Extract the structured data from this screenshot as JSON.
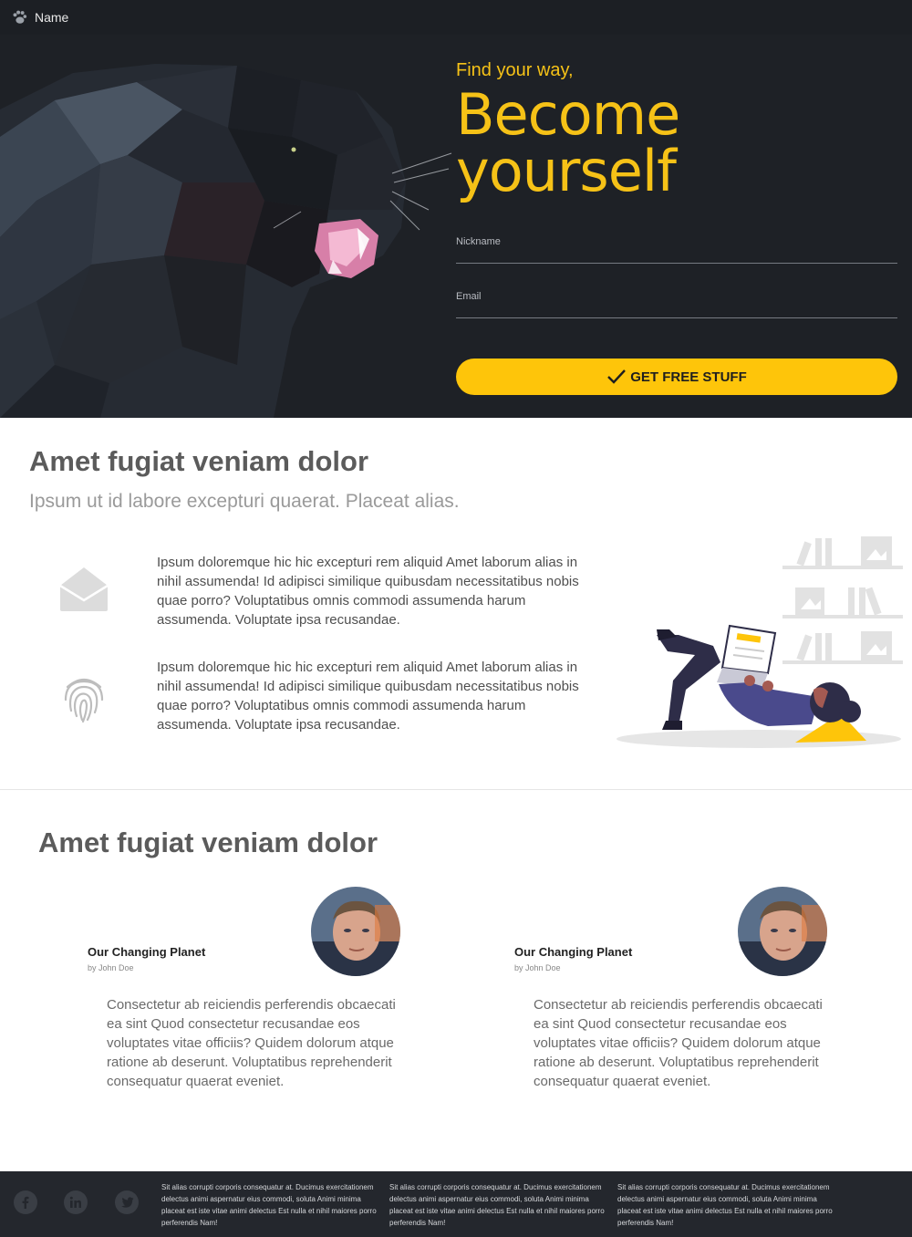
{
  "topbar": {
    "brand_name": "Name",
    "brand_icon": "paw-icon"
  },
  "hero": {
    "tagline": "Find your way,",
    "headline": "Become yourself",
    "nickname_label": "Nickname",
    "nickname_value": "",
    "email_label": "Email",
    "email_value": "",
    "cta_label": "GET FREE STUFF",
    "accent_color": "#fec50a",
    "background_color": "#1e2126"
  },
  "features": {
    "title": "Amet fugiat veniam dolor",
    "subtitle": "Ipsum ut id labore excepturi quaerat. Placeat alias.",
    "items": [
      {
        "icon": "envelope-icon",
        "text": "Ipsum doloremque hic hic excepturi rem aliquid Amet laborum alias in nihil assumenda! Id adipisci similique quibusdam necessitatibus nobis quae porro? Voluptatibus omnis commodi assumenda harum assumenda. Voluptate ipsa recusandae."
      },
      {
        "icon": "fingerprint-icon",
        "text": "Ipsum doloremque hic hic excepturi rem aliquid Amet laborum alias in nihil assumenda! Id adipisci similique quibusdam necessitatibus nobis quae porro? Voluptatibus omnis commodi assumenda harum assumenda. Voluptate ipsa recusandae."
      }
    ]
  },
  "articles": {
    "title": "Amet fugiat veniam dolor",
    "cards": [
      {
        "heading": "Our Changing Planet",
        "byline": "by John Doe",
        "body": "Consectetur ab reiciendis perferendis obcaecati ea sint Quod consectetur recusandae eos voluptates vitae officiis? Quidem dolorum atque ratione ab deserunt. Voluptatibus reprehenderit consequatur quaerat eveniet."
      },
      {
        "heading": "Our Changing Planet",
        "byline": "by John Doe",
        "body": "Consectetur ab reiciendis perferendis obcaecati ea sint Quod consectetur recusandae eos voluptates vitae officiis? Quidem dolorum atque ratione ab deserunt. Voluptatibus reprehenderit consequatur quaerat eveniet."
      }
    ]
  },
  "footer": {
    "social": [
      "facebook-icon",
      "linkedin-icon",
      "twitter-icon"
    ],
    "columns": [
      "Sit alias corrupti corporis consequatur at. Ducimus exercitationem delectus animi aspernatur eius commodi, soluta Animi minima placeat est iste vitae animi delectus Est nulla et nihil maiores porro perferendis Nam!",
      "Sit alias corrupti corporis consequatur at. Ducimus exercitationem delectus animi aspernatur eius commodi, soluta Animi minima placeat est iste vitae animi delectus Est nulla et nihil maiores porro perferendis Nam!",
      "Sit alias corrupti corporis consequatur at. Ducimus exercitationem delectus animi aspernatur eius commodi, soluta Animi minima placeat est iste vitae animi delectus Est nulla et nihil maiores porro perferendis Nam!"
    ]
  }
}
